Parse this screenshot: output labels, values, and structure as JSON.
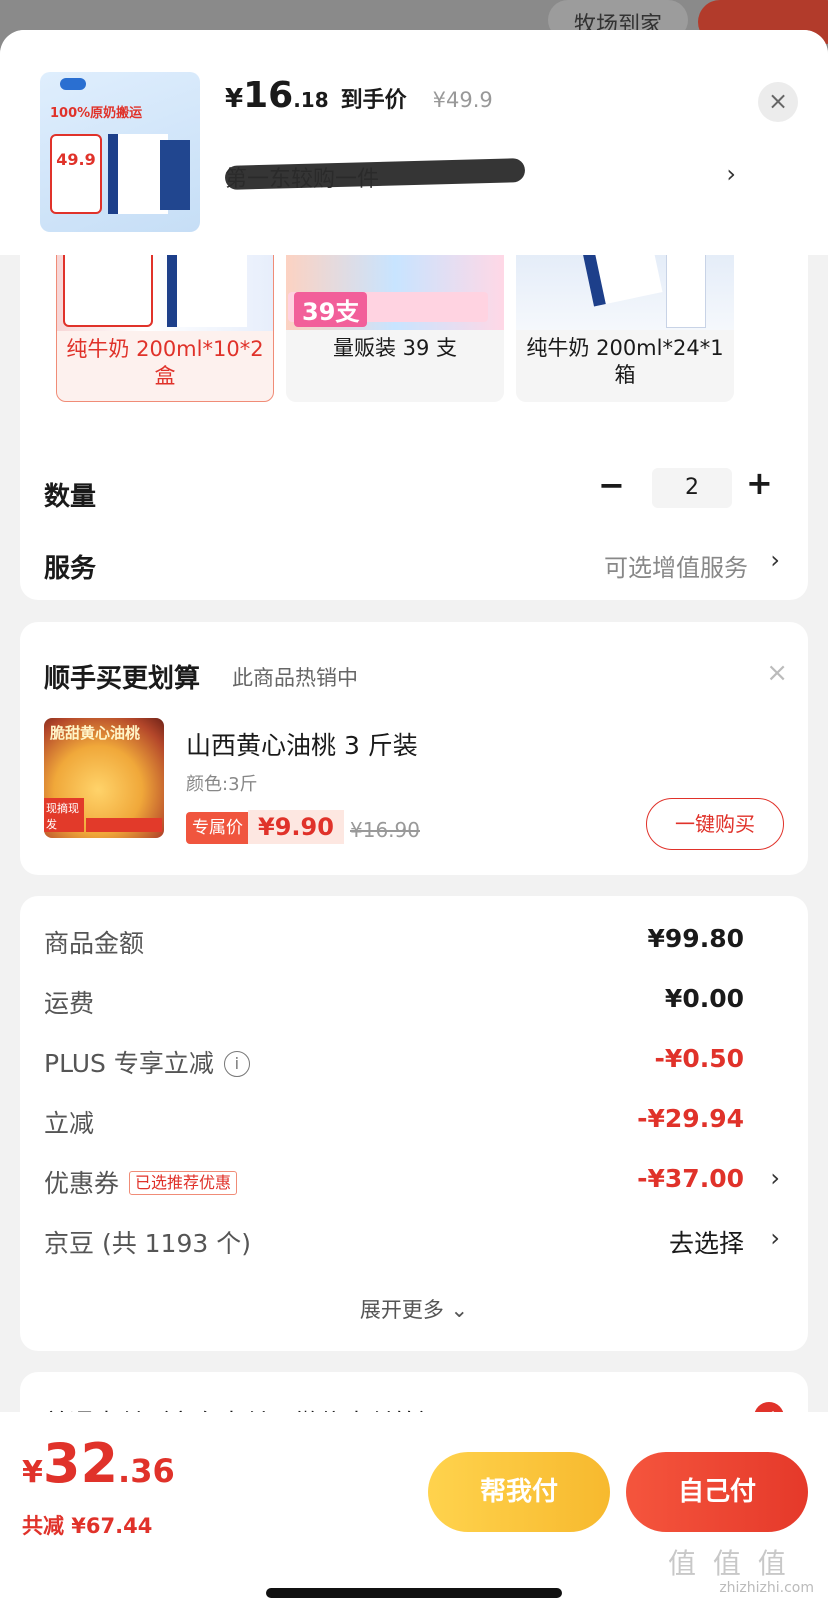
{
  "backdrop": {
    "right_text": "牧场到家"
  },
  "header": {
    "thumb_badge_title": "100%原奶搬运",
    "thumb_price": "49.9",
    "yen": "¥",
    "price_int": "16",
    "price_dec": ".18",
    "price_label": "到手价",
    "orig_price": "¥49.9",
    "spec_text": "第一东较购一件",
    "close_label": "×",
    "chevron": "›"
  },
  "variants": [
    {
      "label": "纯牛奶 200ml*10*2盒",
      "selected": true
    },
    {
      "label": "量贩装 39 支",
      "badge": "39支",
      "selected": false
    },
    {
      "label": "纯牛奶 200ml*24*1箱",
      "selected": false
    }
  ],
  "quantity": {
    "label": "数量",
    "value": "2",
    "minus": "−",
    "plus": "+"
  },
  "service": {
    "label": "服务",
    "value": "可选增值服务",
    "chevron": "›"
  },
  "bundle": {
    "title": "顺手买更划算",
    "subtitle": "此商品热销中",
    "close": "×",
    "img_text": "脆甜黄心油桃",
    "img_tag": "现摘现发",
    "name": "山西黄心油桃 3 斤装",
    "spec": "颜色:3斤",
    "excl_label": "专属价",
    "price": "¥9.90",
    "orig_price": "¥16.90",
    "buy_button": "一键购买"
  },
  "summary": {
    "rows": [
      {
        "label": "商品金额",
        "value": "¥99.80",
        "red": false
      },
      {
        "label": "运费",
        "value": "¥0.00",
        "red": false
      },
      {
        "label": "PLUS 专享立减",
        "value": "-¥0.50",
        "red": true,
        "info_icon": "i"
      },
      {
        "label": "立减",
        "value": "-¥29.94",
        "red": true
      },
      {
        "label": "优惠券",
        "tag": "已选推荐优惠",
        "value": "-¥37.00",
        "red": true,
        "chevron": "›"
      },
      {
        "label": "京豆 (共 1193 个)",
        "value": "去选择",
        "red": false,
        "chevron": "›"
      }
    ],
    "expand": "展开更多 ⌄"
  },
  "payment": {
    "label": "普通支付（京东支付、微信支付等）",
    "check": "✓"
  },
  "bottom": {
    "yen": "¥",
    "total_int": "32",
    "total_dec": ".36",
    "saved": "共减 ¥67.44",
    "help_pay": "帮我付",
    "self_pay": "自己付",
    "watermark": "值 值 值",
    "watermark_url": "zhizhizhi.com"
  },
  "colors": {
    "accent": "#e0322a",
    "help_btn": "#f7b92e",
    "bg": "#f2f2f2"
  }
}
